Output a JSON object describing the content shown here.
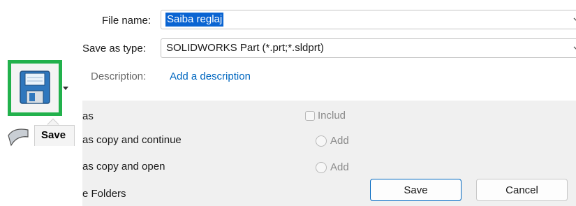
{
  "dialog": {
    "file_name_label": "File name:",
    "file_name_value": "Saiba reglaj",
    "save_as_type_label": "Save as type:",
    "save_as_type_value": "SOLIDWORKS Part (*.prt;*.sldprt)",
    "description_label": "Description:",
    "description_link": "Add a description"
  },
  "options": {
    "save_as": "as",
    "save_as_copy_continue": "as copy and continue",
    "save_as_copy_open": "as copy and open",
    "include_label": "Includ",
    "add_label_1": "Add",
    "add_label_2": "Add",
    "folders": "e Folders"
  },
  "buttons": {
    "save": "Save",
    "cancel": "Cancel"
  },
  "toolbar": {
    "tooltip": "Save"
  },
  "colors": {
    "highlight": "#22b14c",
    "selection": "#0a64d2",
    "link": "#0067c0"
  }
}
